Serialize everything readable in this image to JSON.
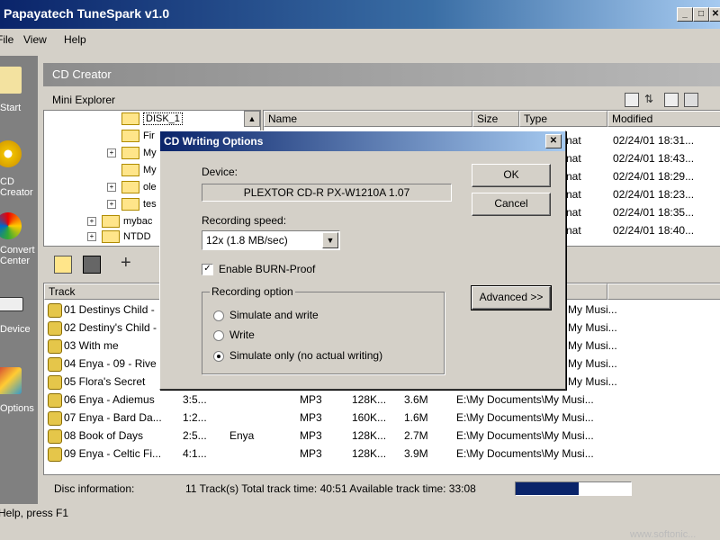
{
  "window": {
    "title": "Papayatech TuneSpark v1.0",
    "min": "_",
    "max": "□",
    "close": "✕"
  },
  "menu": [
    "File",
    "View",
    "Help"
  ],
  "sidebar": [
    {
      "label": "Start",
      "icon": "home-icon"
    },
    {
      "label": "CD Creator",
      "icon": "cd-icon"
    },
    {
      "label": "Convert Center",
      "icon": "convert-icon"
    },
    {
      "label": "Device",
      "icon": "device-icon"
    },
    {
      "label": "Options",
      "icon": "options-icon"
    }
  ],
  "section_title": "CD Creator",
  "mini_explorer": {
    "title": "Mini Explorer",
    "tree": [
      "DISK_1",
      "Fir",
      "My",
      "My",
      "ole",
      "tes",
      "mybac",
      "NTDD"
    ],
    "columns": [
      "Name",
      "Size",
      "Type",
      "Modified"
    ],
    "type_fragments": [
      "nat",
      "nat",
      "nat",
      "nat",
      "nat",
      "nat"
    ],
    "modified": [
      "02/24/01 18:31...",
      "02/24/01 18:43...",
      "02/24/01 18:29...",
      "02/24/01 18:23...",
      "02/24/01 18:35...",
      "02/24/01 18:40..."
    ]
  },
  "tracks": {
    "column": "Track",
    "rows": [
      {
        "name": "01 Destinys Child -",
        "time": "",
        "artist": "",
        "fmt": "",
        "rate": "",
        "size": "",
        "path": "My Musi..."
      },
      {
        "name": "02 Destiny's Child -",
        "time": "",
        "artist": "",
        "fmt": "",
        "rate": "",
        "size": "",
        "path": "My Musi..."
      },
      {
        "name": "03 With me",
        "time": "",
        "artist": "",
        "fmt": "",
        "rate": "",
        "size": "",
        "path": "My Musi..."
      },
      {
        "name": "04 Enya - 09 - Rive",
        "time": "",
        "artist": "",
        "fmt": "",
        "rate": "",
        "size": "",
        "path": "My Musi..."
      },
      {
        "name": "05 Flora's Secret",
        "time": "",
        "artist": "",
        "fmt": "",
        "rate": "",
        "size": "",
        "path": "My Musi..."
      },
      {
        "name": "06 Enya - Adiemus",
        "time": "3:5...",
        "artist": "",
        "fmt": "MP3",
        "rate": "128K...",
        "size": "3.6M",
        "path": "E:\\My Documents\\My Musi..."
      },
      {
        "name": "07 Enya - Bard Da...",
        "time": "1:2...",
        "artist": "",
        "fmt": "MP3",
        "rate": "160K...",
        "size": "1.6M",
        "path": "E:\\My Documents\\My Musi..."
      },
      {
        "name": "08 Book of Days",
        "time": "2:5...",
        "artist": "Enya",
        "fmt": "MP3",
        "rate": "128K...",
        "size": "2.7M",
        "path": "E:\\My Documents\\My Musi..."
      },
      {
        "name": "09 Enya - Celtic Fi...",
        "time": "4:1...",
        "artist": "",
        "fmt": "MP3",
        "rate": "128K...",
        "size": "3.9M",
        "path": "E:\\My Documents\\My Musi..."
      }
    ]
  },
  "disc_info": {
    "label": "Disc information:",
    "text": "11 Track(s)  Total track time: 40:51  Available track time: 33:08",
    "progress": 0.55
  },
  "statusbar": "Help, press F1",
  "dialog": {
    "title": "CD Writing Options",
    "device_label": "Device:",
    "device_value": "PLEXTOR CD-R   PX-W1210A 1.07",
    "speed_label": "Recording speed:",
    "speed_value": "12x (1.8 MB/sec)",
    "burnproof_label": "Enable BURN-Proof",
    "burnproof_checked": true,
    "option_group": "Recording option",
    "options": [
      "Simulate and write",
      "Write",
      "Simulate only (no actual writing)"
    ],
    "selected_option": 2,
    "ok": "OK",
    "cancel": "Cancel",
    "advanced": "Advanced >>"
  },
  "watermark": "www.softonic..."
}
